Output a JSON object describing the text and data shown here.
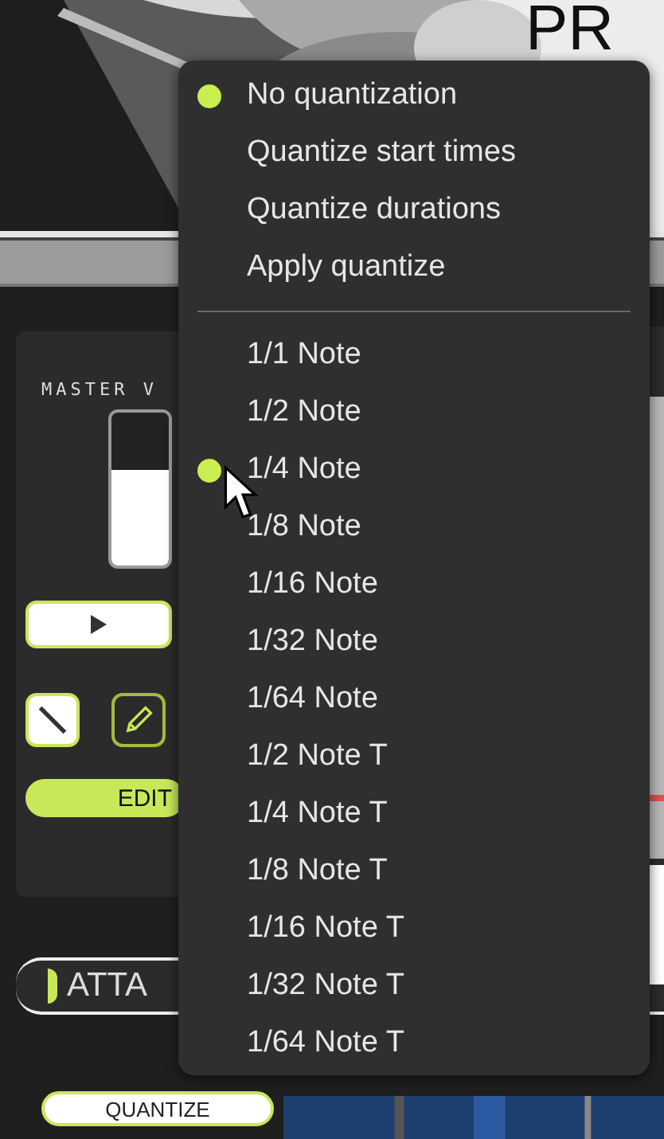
{
  "header": {
    "logo_text": "PR"
  },
  "panel": {
    "master_label": "MASTER V",
    "master_volume": {
      "level": 0.62
    },
    "edit_label": "EDIT",
    "attack_label": "ATTA",
    "quantize_label": "QUANTIZE"
  },
  "menu": {
    "groups": [
      {
        "items": [
          {
            "label": "No quantization",
            "selected": true
          },
          {
            "label": "Quantize start times",
            "selected": false
          },
          {
            "label": "Quantize durations",
            "selected": false
          },
          {
            "label": "Apply quantize",
            "selected": false
          }
        ]
      },
      {
        "items": [
          {
            "label": "1/1 Note",
            "selected": false
          },
          {
            "label": "1/2 Note",
            "selected": false
          },
          {
            "label": "1/4 Note",
            "selected": true
          },
          {
            "label": "1/8 Note",
            "selected": false
          },
          {
            "label": "1/16 Note",
            "selected": false
          },
          {
            "label": "1/32 Note",
            "selected": false
          },
          {
            "label": "1/64 Note",
            "selected": false
          },
          {
            "label": "1/2 Note T",
            "selected": false
          },
          {
            "label": "1/4 Note T",
            "selected": false
          },
          {
            "label": "1/8 Note T",
            "selected": false
          },
          {
            "label": "1/16 Note T",
            "selected": false
          },
          {
            "label": "1/32 Note T",
            "selected": false
          },
          {
            "label": "1/64 Note T",
            "selected": false
          }
        ]
      }
    ]
  }
}
